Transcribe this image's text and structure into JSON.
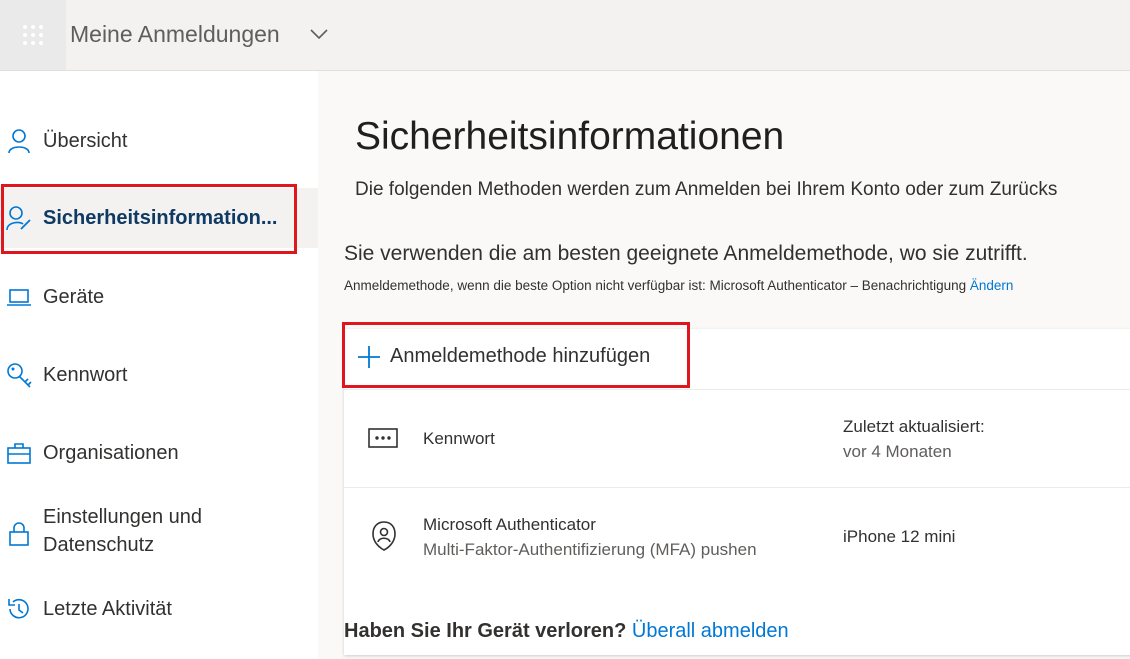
{
  "header": {
    "app_title": "Meine Anmeldungen"
  },
  "sidebar": {
    "items": [
      {
        "label": "Übersicht",
        "icon": "person-icon"
      },
      {
        "label": "Sicherheitsinformation...",
        "icon": "person-edit-icon",
        "active": true
      },
      {
        "label": "Geräte",
        "icon": "laptop-icon"
      },
      {
        "label": "Kennwort",
        "icon": "key-icon"
      },
      {
        "label": "Organisationen",
        "icon": "briefcase-icon"
      },
      {
        "label": "Einstellungen und Datenschutz",
        "icon": "lock-icon"
      },
      {
        "label": "Letzte Aktivität",
        "icon": "history-icon"
      }
    ]
  },
  "main": {
    "title": "Sicherheitsinformationen",
    "description": "Die folgenden Methoden werden zum Anmelden bei Ihrem Konto oder zum Zurücks",
    "default_heading": "Sie verwenden die am besten geeignete Anmeldemethode, wo sie zutrifft.",
    "default_sub": "Anmeldemethode, wenn die beste Option nicht verfügbar ist: Microsoft Authenticator – Benachrichtigung",
    "change_link": "Ändern",
    "add_method_label": "Anmeldemethode hinzufügen",
    "methods": [
      {
        "name": "Kennwort",
        "detail_label": "Zuletzt aktualisiert:",
        "detail_value": "vor 4 Monaten"
      },
      {
        "name": "Microsoft Authenticator",
        "subtitle": "Multi-Faktor-Authentifizierung (MFA) pushen",
        "detail_value": "iPhone 12 mini"
      }
    ],
    "lost_question": "Haben Sie Ihr Gerät verloren?",
    "lost_link": "Überall abmelden"
  },
  "colors": {
    "accent": "#0078d4",
    "highlight": "#e0161f",
    "active_text": "#0f3a64"
  }
}
